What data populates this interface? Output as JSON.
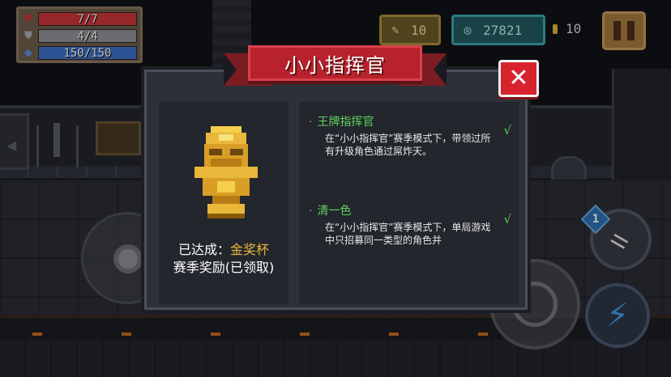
{
  "hud": {
    "hp": "7/7",
    "armor": "4/4",
    "energy": "150/150",
    "gems": "10",
    "coins": "27821",
    "gold": "10",
    "colors": {
      "hp": "#c9343a",
      "armor": "#8d8f94",
      "energy": "#3c6fc6"
    },
    "icons": {
      "hp": "heart-icon",
      "armor": "shield-icon",
      "energy": "energy-crystal-icon",
      "gems": "feather-icon",
      "coins": "gem-coin-icon",
      "pause": "pause-icon"
    }
  },
  "dialog": {
    "title": "小小指挥官",
    "reward": {
      "achieved_label": "已达成：",
      "achieved_value": "金奖杯",
      "season_reward": "赛季奖励(已领取)"
    },
    "achievements": [
      {
        "title": "王牌指挥官",
        "desc": "在“小小指挥官”赛季模式下，带领过所有升级角色通过屌炸天。",
        "check": "√"
      },
      {
        "title": "清一色",
        "desc": "在“小小指挥官”赛季模式下，单局游戏中只招募同一类型的角色并",
        "check": "√"
      }
    ],
    "bullet": "·",
    "colors": {
      "banner": "#b7222c",
      "close": "#d8232e",
      "achievement_title": "#5fd35f",
      "trophy": "#e9b73a"
    }
  },
  "controls": {
    "weapon_count": "1",
    "icons": {
      "joystick": "joystick-icon",
      "attack": "crosshair-icon",
      "skill": "lightning-bolt-icon",
      "weapon": "bone-icon"
    }
  }
}
